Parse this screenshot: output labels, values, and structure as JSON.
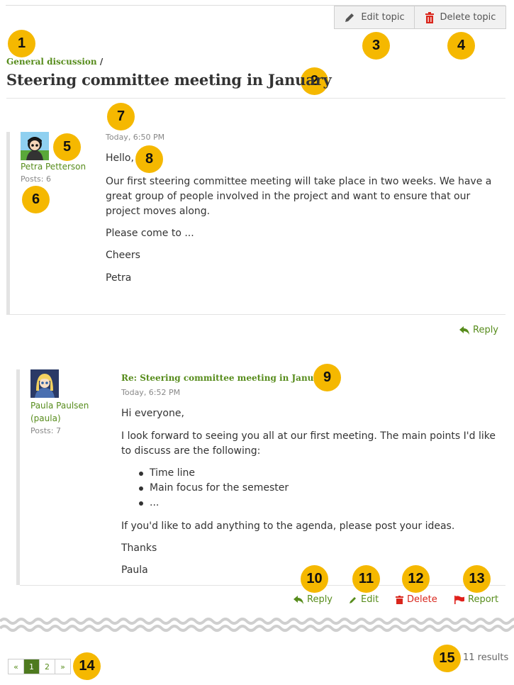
{
  "toolbar": {
    "edit_topic": "Edit topic",
    "delete_topic": "Delete topic"
  },
  "breadcrumb": {
    "forum": "General discussion",
    "separator": "/"
  },
  "topic_title": "Steering committee meeting in January",
  "post1": {
    "author": "Petra Petterson",
    "posts": "Posts: 6",
    "time": "Today, 6:50 PM",
    "body": [
      "Hello,",
      "Our first steering committee meeting will take place in two weeks. We have a great group of people involved in the project and want to ensure that our project moves along.",
      "Please come to ...",
      "Cheers",
      "Petra"
    ],
    "reply": "Reply"
  },
  "post2": {
    "subject": "Re: Steering committee meeting in January",
    "author_line1": "Paula Paulsen",
    "author_line2": "(paula)",
    "posts": "Posts: 7",
    "time": "Today, 6:52 PM",
    "intro": "Hi everyone,",
    "para": "I look forward to seeing you all at our first meeting. The main points I'd like to discuss are the following:",
    "list": [
      "Time line",
      "Main focus for the semester",
      "..."
    ],
    "after": "If you'd like to add anything to the agenda, please post your ideas.",
    "thanks": "Thanks",
    "sign": "Paula",
    "actions": {
      "reply": "Reply",
      "edit": "Edit",
      "delete": "Delete",
      "report": "Report"
    }
  },
  "pagination": {
    "prev": "«",
    "pages": [
      "1",
      "2"
    ],
    "next": "»",
    "results": "11 results"
  },
  "callouts": [
    "1",
    "2",
    "3",
    "4",
    "5",
    "6",
    "7",
    "8",
    "9",
    "10",
    "11",
    "12",
    "13",
    "14",
    "15"
  ],
  "colors": {
    "accent_green": "#578c1c",
    "badge": "#f5b800",
    "delete_red": "#d9261c",
    "report_red": "#e0201b"
  }
}
